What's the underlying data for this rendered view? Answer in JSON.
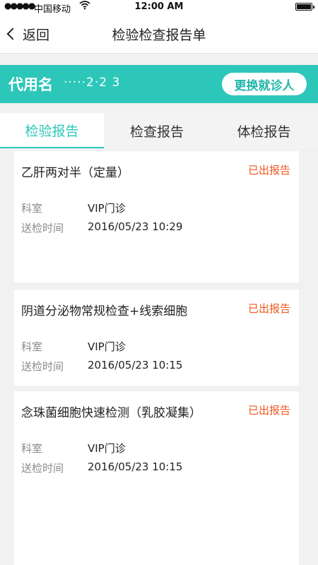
{
  "status_bar": {
    "signal": "●●●●●",
    "carrier": "中国移动",
    "wifi_icon": "wifi-icon",
    "time": "12:00 AM",
    "battery_icon": "battery-icon"
  },
  "nav": {
    "back_label": "返回",
    "title": "检验检查报告单"
  },
  "patient": {
    "label": "代用名",
    "name": "·····2·2 3",
    "change_button": "更换就诊人"
  },
  "tabs": [
    {
      "label": "检验报告",
      "active": true
    },
    {
      "label": "检查报告",
      "active": false
    },
    {
      "label": "体检报告",
      "active": false
    }
  ],
  "colors": {
    "accent": "#2cc7b8",
    "status": "#f0571e",
    "background": "#f1f1f1"
  },
  "reports": [
    {
      "title": "乙肝两对半（定量）",
      "status": "已出报告",
      "dept_label": "科室",
      "dept": "VIP门诊",
      "time_label": "送检时间",
      "time": "2016/05/23 10:29"
    },
    {
      "title": "阴道分泌物常规检查+线索细胞",
      "status": "已出报告",
      "dept_label": "科室",
      "dept": "VIP门诊",
      "time_label": "送检时间",
      "time": "2016/05/23 10:15"
    },
    {
      "title": "念珠菌细胞快速检测（乳胶凝集）",
      "status": "已出报告",
      "dept_label": "科室",
      "dept": "VIP门诊",
      "time_label": "送检时间",
      "time": "2016/05/23 10:15"
    }
  ]
}
